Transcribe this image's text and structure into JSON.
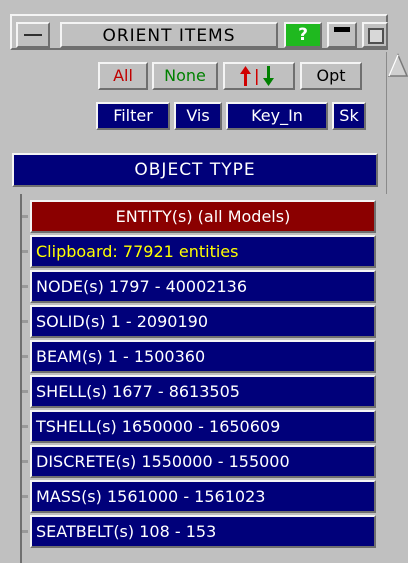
{
  "window": {
    "title": "ORIENT ITEMS",
    "help_label": "?"
  },
  "toolbar": {
    "all_label": "All",
    "none_label": "None",
    "opt_label": "Opt",
    "filter_label": "Filter",
    "vis_label": "Vis",
    "keyin_label": "Key_In",
    "sk_label": "Sk"
  },
  "object_type_label": "OBJECT TYPE",
  "list": {
    "items": [
      {
        "label": "ENTITY(s) (all Models)",
        "kind": "entity"
      },
      {
        "label": "Clipboard: 77921 entities",
        "kind": "clipboard"
      },
      {
        "label": "NODE(s) 1797 - 40002136",
        "kind": "normal"
      },
      {
        "label": "SOLID(s) 1 - 2090190",
        "kind": "normal"
      },
      {
        "label": "BEAM(s) 1 - 1500360",
        "kind": "normal"
      },
      {
        "label": "SHELL(s) 1677 - 8613505",
        "kind": "normal"
      },
      {
        "label": "TSHELL(s) 1650000 - 1650609",
        "kind": "normal"
      },
      {
        "label": "DISCRETE(s) 1550000 - 155000",
        "kind": "normal"
      },
      {
        "label": "MASS(s) 1561000 - 1561023",
        "kind": "normal"
      },
      {
        "label": "SEATBELT(s) 108 - 153",
        "kind": "normal"
      }
    ]
  },
  "colors": {
    "panel": "#c0c0c0",
    "dark_blue": "#00007a",
    "entity_red": "#8b0000",
    "help_green": "#1fb91f",
    "clipboard_text": "#ffff00"
  },
  "icons": {
    "minimize": "minimize-icon",
    "help": "help-icon",
    "sort": "sort-arrows-icon",
    "scroll_up": "scroll-up-arrow-icon"
  }
}
